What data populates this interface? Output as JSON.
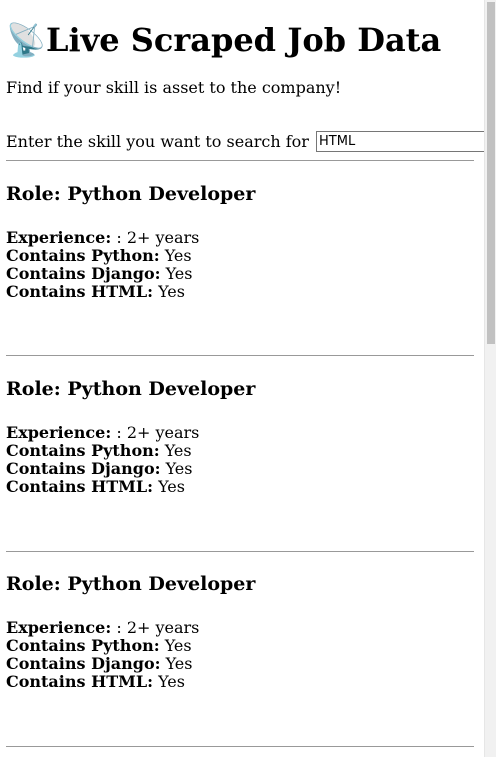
{
  "header": {
    "icon": "satellite-antenna-icon",
    "icon_glyph": "📡",
    "title": "Live Scraped Job Data",
    "subtitle": "Find if your skill is asset to the company!"
  },
  "search": {
    "label": "Enter the skill you want to search for",
    "value": "HTML"
  },
  "jobs": [
    {
      "role": "Role: Python Developer",
      "experience_label": "Experience:",
      "experience_value": " : 2+ years",
      "python_label": "Contains Python:",
      "python_value": " Yes",
      "django_label": "Contains Django:",
      "django_value": " Yes",
      "html_label": "Contains HTML:",
      "html_value": " Yes"
    },
    {
      "role": "Role: Python Developer",
      "experience_label": "Experience:",
      "experience_value": " : 2+ years",
      "python_label": "Contains Python:",
      "python_value": " Yes",
      "django_label": "Contains Django:",
      "django_value": " Yes",
      "html_label": "Contains HTML:",
      "html_value": " Yes"
    },
    {
      "role": "Role: Python Developer",
      "experience_label": "Experience:",
      "experience_value": " : 2+ years",
      "python_label": "Contains Python:",
      "python_value": " Yes",
      "django_label": "Contains Django:",
      "django_value": " Yes",
      "html_label": "Contains HTML:",
      "html_value": " Yes"
    }
  ]
}
